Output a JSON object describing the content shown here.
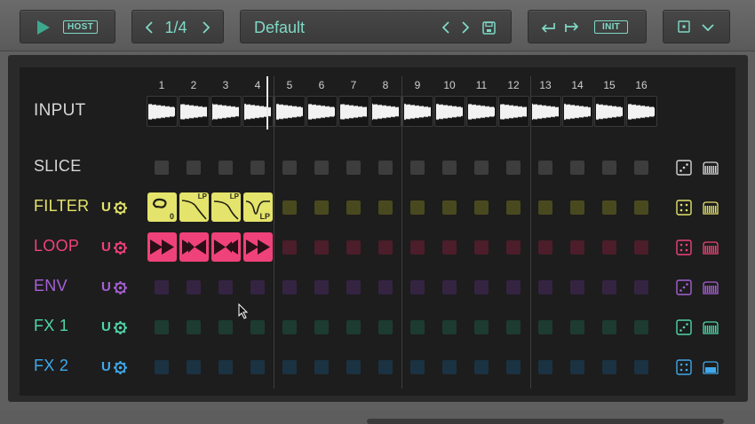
{
  "toolbar": {
    "host_label": "HOST",
    "page_indicator": "1/4",
    "preset_name": "Default",
    "init_label": "INIT"
  },
  "columns": [
    "1",
    "2",
    "3",
    "4",
    "5",
    "6",
    "7",
    "8",
    "9",
    "10",
    "11",
    "12",
    "13",
    "14",
    "15",
    "16"
  ],
  "input": {
    "label": "INPUT"
  },
  "rows": [
    {
      "key": "slice",
      "label": "SLICE",
      "u": "",
      "color": "#d6d6d6",
      "cell": "#3d3d3d"
    },
    {
      "key": "filter",
      "label": "FILTER",
      "u": "U",
      "color": "#e4e36b",
      "cell": "#49491f"
    },
    {
      "key": "loop",
      "label": "LOOP",
      "u": "U",
      "color": "#f0427a",
      "cell": "#4c1d2b"
    },
    {
      "key": "env",
      "label": "ENV",
      "u": "U",
      "color": "#a760d6",
      "cell": "#342442"
    },
    {
      "key": "fx1",
      "label": "FX 1",
      "u": "U",
      "color": "#4fd6a8",
      "cell": "#1d3b31"
    },
    {
      "key": "fx2",
      "label": "FX 2",
      "u": "U",
      "color": "#3fa9ec",
      "cell": "#1b3243"
    }
  ],
  "filter_tiles": [
    {
      "tag": "",
      "sub": "0"
    },
    {
      "tag": "LP",
      "sub": ""
    },
    {
      "tag": "LP",
      "sub": ""
    },
    {
      "tag": "",
      "sub": "LP"
    }
  ],
  "playhead_step": 4
}
